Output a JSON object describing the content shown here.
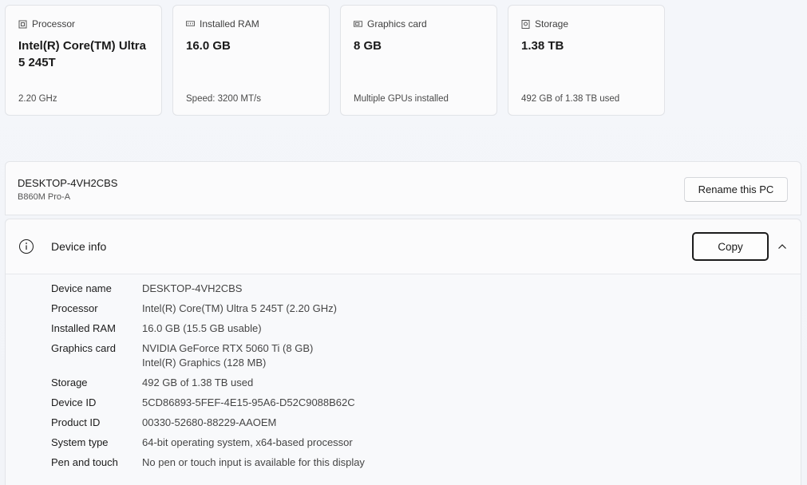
{
  "cards": [
    {
      "icon": "processor-icon",
      "label": "Processor",
      "value": "Intel(R) Core(TM) Ultra 5 245T",
      "sub": "2.20 GHz"
    },
    {
      "icon": "ram-icon",
      "label": "Installed RAM",
      "value": "16.0 GB",
      "sub": "Speed: 3200 MT/s"
    },
    {
      "icon": "graphics-card-icon",
      "label": "Graphics card",
      "value": "8 GB",
      "sub": "Multiple GPUs installed"
    },
    {
      "icon": "storage-icon",
      "label": "Storage",
      "value": "1.38 TB",
      "sub": "492 GB of 1.38 TB used"
    }
  ],
  "pc": {
    "name": "DESKTOP-4VH2CBS",
    "model": "B860M Pro-A",
    "rename_label": "Rename this PC"
  },
  "device_info": {
    "title": "Device info",
    "copy_label": "Copy",
    "rows": [
      {
        "label": "Device name",
        "values": [
          "DESKTOP-4VH2CBS"
        ]
      },
      {
        "label": "Processor",
        "values": [
          "Intel(R) Core(TM) Ultra 5 245T (2.20 GHz)"
        ]
      },
      {
        "label": "Installed RAM",
        "values": [
          "16.0 GB (15.5 GB usable)"
        ]
      },
      {
        "label": "Graphics card",
        "values": [
          "NVIDIA GeForce RTX 5060 Ti (8 GB)",
          "Intel(R) Graphics (128 MB)"
        ]
      },
      {
        "label": "Storage",
        "values": [
          "492 GB of 1.38 TB used"
        ]
      },
      {
        "label": "Device ID",
        "values": [
          "5CD86893-5FEF-4E15-95A6-D52C9088B62C"
        ]
      },
      {
        "label": "Product ID",
        "values": [
          "00330-52680-88229-AAOEM"
        ]
      },
      {
        "label": "System type",
        "values": [
          "64-bit operating system, x64-based processor"
        ]
      },
      {
        "label": "Pen and touch",
        "values": [
          "No pen or touch input is available for this display"
        ]
      }
    ]
  }
}
